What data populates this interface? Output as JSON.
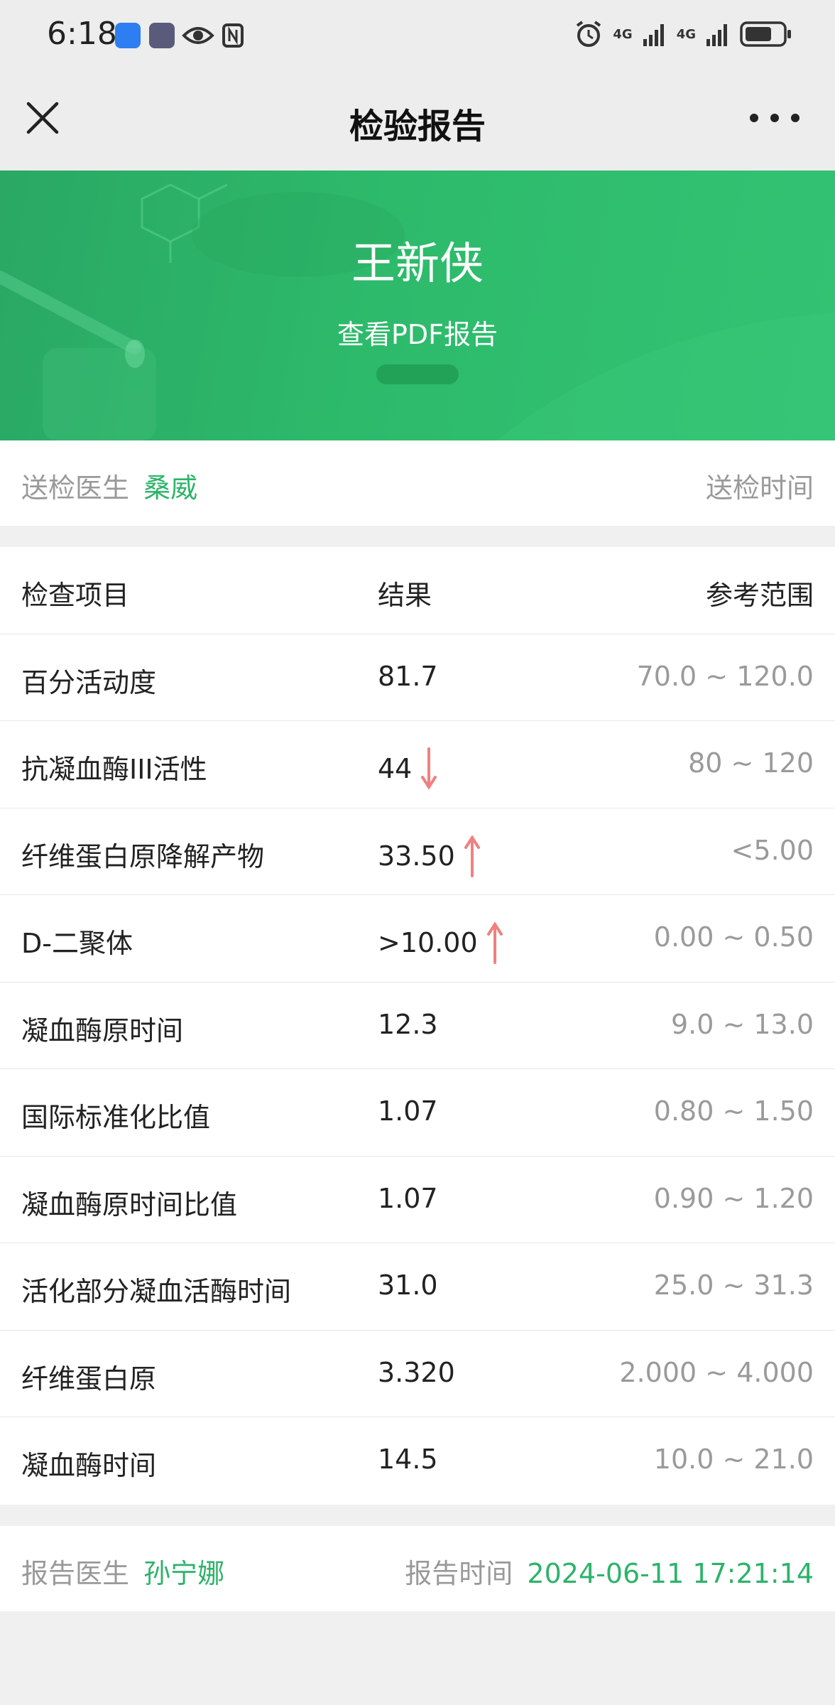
{
  "status_bar": {
    "time": "6:18",
    "network_1": "4G",
    "network_2": "4G"
  },
  "nav": {
    "title": "检验报告"
  },
  "banner": {
    "patient_name": "王新侠",
    "pdf_link": "查看PDF报告"
  },
  "doctor_row": {
    "label": "送检医生",
    "doctor": "桑威",
    "time_label": "送检时间"
  },
  "table": {
    "headers": {
      "item": "检查项目",
      "result": "结果",
      "range": "参考范围"
    },
    "rows": [
      {
        "item": "百分活动度",
        "result": "81.7",
        "flag": "",
        "range": "70.0 ~ 120.0"
      },
      {
        "item": "抗凝血酶III活性",
        "result": "44",
        "flag": "down",
        "range": "80 ~ 120"
      },
      {
        "item": "纤维蛋白原降解产物",
        "result": "33.50",
        "flag": "up",
        "range": "<5.00"
      },
      {
        "item": "D-二聚体",
        "result": ">10.00",
        "flag": "up",
        "range": "0.00 ~ 0.50"
      },
      {
        "item": "凝血酶原时间",
        "result": "12.3",
        "flag": "",
        "range": "9.0 ~ 13.0"
      },
      {
        "item": "国际标准化比值",
        "result": "1.07",
        "flag": "",
        "range": "0.80 ~ 1.50"
      },
      {
        "item": "凝血酶原时间比值",
        "result": "1.07",
        "flag": "",
        "range": "0.90 ~ 1.20"
      },
      {
        "item": "活化部分凝血活酶时间",
        "result": "31.0",
        "flag": "",
        "range": "25.0 ~ 31.3"
      },
      {
        "item": "纤维蛋白原",
        "result": "3.320",
        "flag": "",
        "range": "2.000 ~ 4.000"
      },
      {
        "item": "凝血酶时间",
        "result": "14.5",
        "flag": "",
        "range": "10.0 ~ 21.0"
      }
    ]
  },
  "report_row": {
    "label": "报告医生",
    "doctor": "孙宁娜",
    "time_label": "报告时间",
    "time": "2024-06-11 17:21:14"
  },
  "colors": {
    "accent_green": "#2db36a",
    "banner_green": "#2dba6b",
    "arrow_red": "#f08080"
  }
}
